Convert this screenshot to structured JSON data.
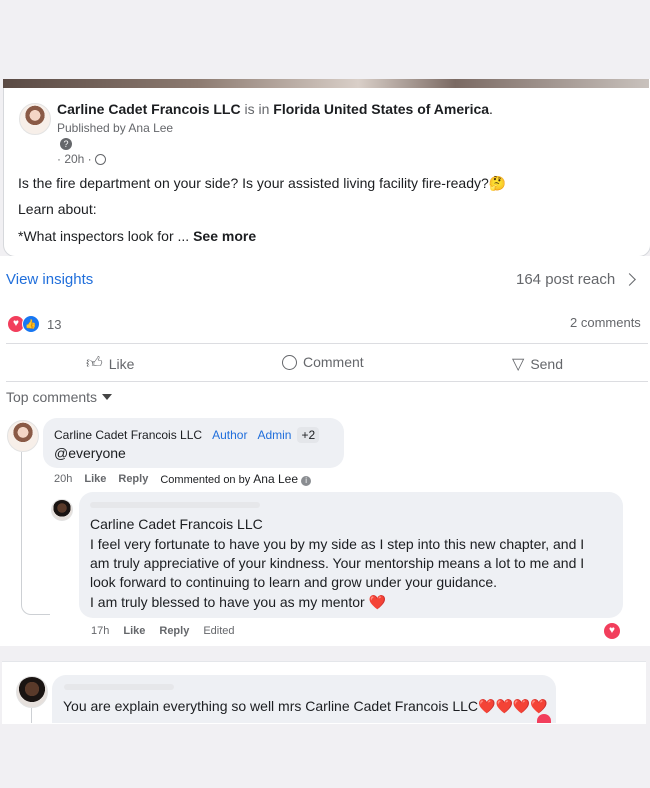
{
  "post": {
    "page_name": "Carline Cadet Francois LLC",
    "is_in": "is in",
    "location": "Florida United States of America",
    "period": ".",
    "published_by": "Published by Ana Lee",
    "time": "· 20h ·",
    "line1": "Is the fire department on your side? Is your assisted living facility fire-ready?🤔",
    "line2": "Learn about:",
    "line3_prefix": "*What inspectors look for ...",
    "see_more": "See more"
  },
  "insights": {
    "view_insights": "View insights",
    "reach": "164 post reach"
  },
  "reactions": {
    "count": "13",
    "comments": "2 comments"
  },
  "actions": {
    "like": "Like",
    "comment": "Comment",
    "send": "Send"
  },
  "top_comments": "Top comments",
  "comment1": {
    "author": "Carline Cadet Francois LLC",
    "badge_author": "Author",
    "badge_admin": "Admin",
    "badge_more": "+2",
    "text": "@everyone",
    "time": "20h",
    "like": "Like",
    "reply": "Reply",
    "commented_on_by": "Commented on by",
    "commented_by_name": "Ana Lee"
  },
  "reply1": {
    "mention": "Carline Cadet Francois LLC",
    "line1": "I feel very fortunate to have you by my side as I step into this new chapter, and I",
    "line2": "am truly appreciative of your kindness. Your mentorship means a lot to me and I",
    "line3": "look forward to continuing to learn and grow under your guidance.",
    "line4": "I am truly blessed to have you as my mentor ❤️",
    "time": "17h",
    "like": "Like",
    "reply": "Reply",
    "edited": "Edited"
  },
  "comment2": {
    "text_prefix": "You are explain everything so well mrs",
    "mention": "Carline Cadet Francois LLC",
    "hearts": "❤️❤️❤️❤️"
  },
  "colors": {
    "link": "#216fdb",
    "heart": "#f23e5c",
    "like_blue": "#1877f2"
  }
}
